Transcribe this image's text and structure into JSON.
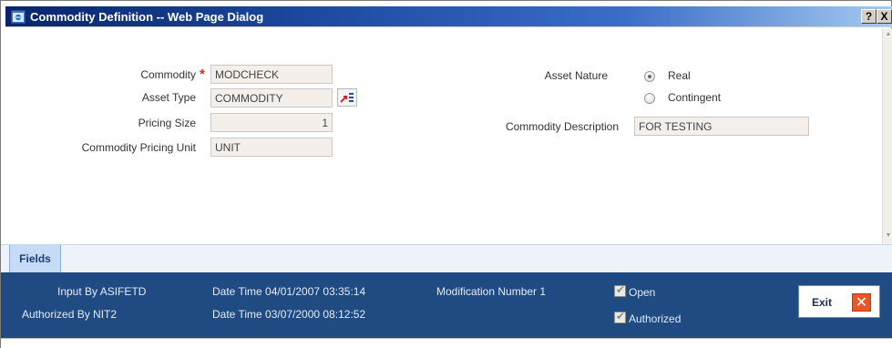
{
  "window": {
    "title": "Commodity Definition -- Web Page Dialog",
    "help_label": "?",
    "close_label": "X"
  },
  "form": {
    "commodity_label": "Commodity",
    "required_mark": "*",
    "commodity_value": "MODCHECK",
    "asset_type_label": "Asset Type",
    "asset_type_value": "COMMODITY",
    "pricing_size_label": "Pricing Size",
    "pricing_size_value": "1",
    "pricing_unit_label": "Commodity Pricing Unit",
    "pricing_unit_value": "UNIT",
    "asset_nature_label": "Asset Nature",
    "asset_nature_options": [
      {
        "label": "Real",
        "checked": true
      },
      {
        "label": "Contingent",
        "checked": false
      }
    ],
    "description_label": "Commodity Description",
    "description_value": "FOR TESTING"
  },
  "tabs": [
    {
      "label": "Fields"
    }
  ],
  "footer": {
    "input_by": "Input By ASIFETD",
    "input_datetime": "Date Time 04/01/2007 03:35:14",
    "modification_number": "Modification Number 1",
    "authorized_by": "Authorized By NIT2",
    "authorized_datetime": "Date Time 03/07/2000 08:12:52",
    "open_label": "Open",
    "open_checked": true,
    "authorized_label": "Authorized",
    "authorized_checked": true,
    "exit_label": "Exit"
  },
  "colors": {
    "title_bar": "#0a246a",
    "footer": "#204b82",
    "field_bg": "#f4efeb",
    "required": "#d9262e",
    "exit_icon": "#e8572a"
  }
}
